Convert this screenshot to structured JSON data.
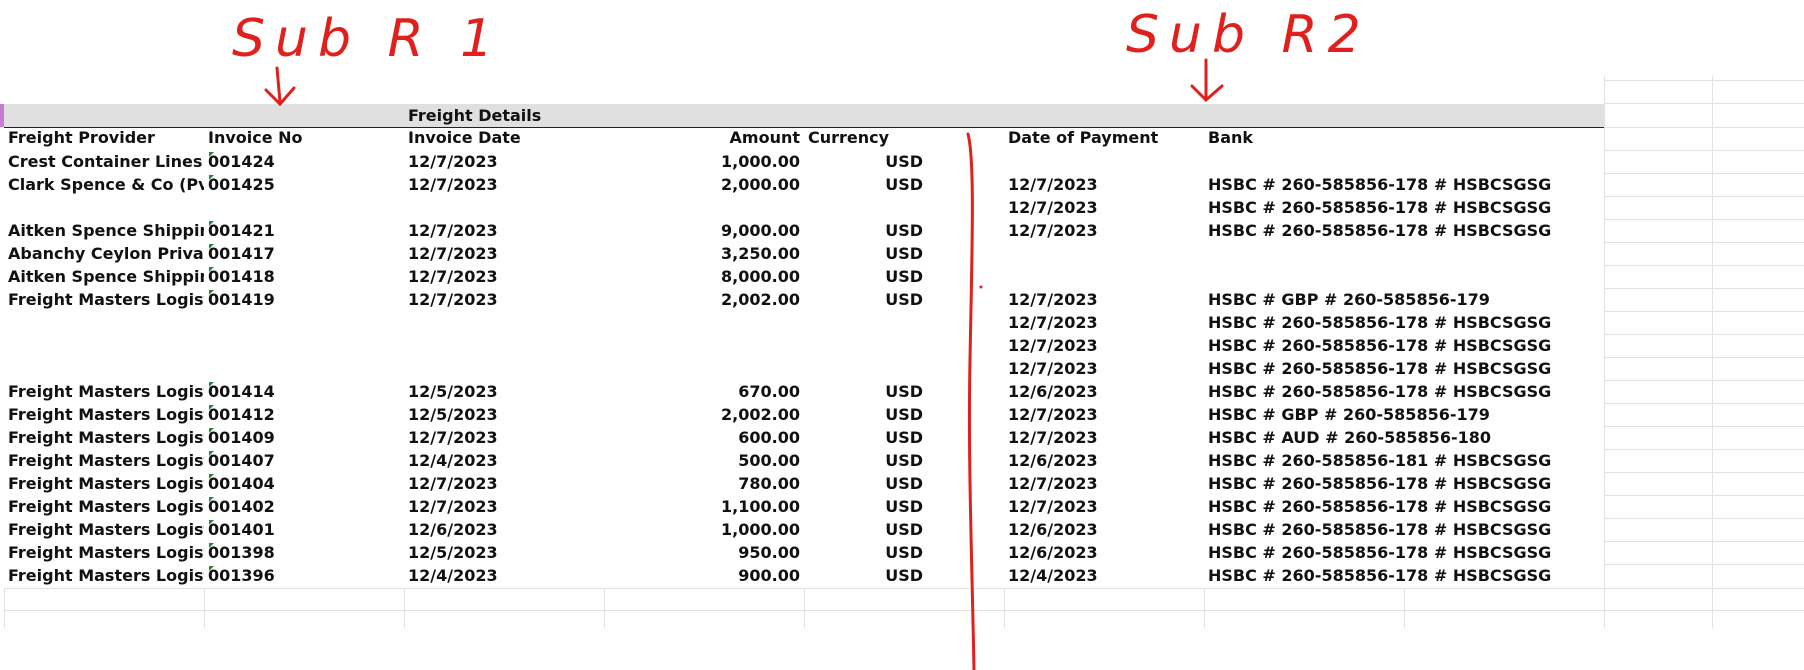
{
  "section_title": "Freight Details",
  "columns": {
    "provider": "Freight Provider",
    "invoice_no": "Invoice No",
    "invoice_date": "Invoice Date",
    "amount": "Amount",
    "currency": "Currency",
    "payment_date": "Date of Payment",
    "bank": "Bank"
  },
  "annotations": {
    "left": "Sub R 1",
    "right": "Sub R2",
    "annotation_color": "#e0201c"
  },
  "rows": [
    {
      "provider": "Crest Container Lines In",
      "invoice_no": "001424",
      "invoice_date": "12/7/2023",
      "amount": "1,000.00",
      "currency": "USD",
      "payment_date": "",
      "bank": ""
    },
    {
      "provider": "Clark Spence & Co (Pvt)",
      "invoice_no": "001425",
      "invoice_date": "12/7/2023",
      "amount": "2,000.00",
      "currency": "USD",
      "payment_date": "12/7/2023",
      "bank": "HSBC # 260-585856-178 # HSBCSGSG"
    },
    {
      "provider": "",
      "invoice_no": "",
      "invoice_date": "",
      "amount": "",
      "currency": "",
      "payment_date": "12/7/2023",
      "bank": "HSBC # 260-585856-178 # HSBCSGSG"
    },
    {
      "provider": "Aitken Spence Shipping",
      "invoice_no": "001421",
      "invoice_date": "12/7/2023",
      "amount": "9,000.00",
      "currency": "USD",
      "payment_date": "12/7/2023",
      "bank": "HSBC # 260-585856-178 # HSBCSGSG"
    },
    {
      "provider": "Abanchy Ceylon Private",
      "invoice_no": "001417",
      "invoice_date": "12/7/2023",
      "amount": "3,250.00",
      "currency": "USD",
      "payment_date": "",
      "bank": ""
    },
    {
      "provider": "Aitken Spence Shipping",
      "invoice_no": "001418",
      "invoice_date": "12/7/2023",
      "amount": "8,000.00",
      "currency": "USD",
      "payment_date": "",
      "bank": ""
    },
    {
      "provider": "Freight Masters Logistic",
      "invoice_no": "001419",
      "invoice_date": "12/7/2023",
      "amount": "2,002.00",
      "currency": "USD",
      "payment_date": "12/7/2023",
      "bank": "HSBC # GBP # 260-585856-179"
    },
    {
      "provider": "",
      "invoice_no": "",
      "invoice_date": "",
      "amount": "",
      "currency": "",
      "payment_date": "12/7/2023",
      "bank": "HSBC # 260-585856-178 # HSBCSGSG"
    },
    {
      "provider": "",
      "invoice_no": "",
      "invoice_date": "",
      "amount": "",
      "currency": "",
      "payment_date": "12/7/2023",
      "bank": "HSBC # 260-585856-178 # HSBCSGSG"
    },
    {
      "provider": "",
      "invoice_no": "",
      "invoice_date": "",
      "amount": "",
      "currency": "",
      "payment_date": "12/7/2023",
      "bank": "HSBC # 260-585856-178 # HSBCSGSG"
    },
    {
      "provider": "Freight Masters Logistic",
      "invoice_no": "001414",
      "invoice_date": "12/5/2023",
      "amount": "670.00",
      "currency": "USD",
      "payment_date": "12/6/2023",
      "bank": "HSBC # 260-585856-178 # HSBCSGSG"
    },
    {
      "provider": "Freight Masters Logistic",
      "invoice_no": "001412",
      "invoice_date": "12/5/2023",
      "amount": "2,002.00",
      "currency": "USD",
      "payment_date": "12/7/2023",
      "bank": "HSBC # GBP # 260-585856-179"
    },
    {
      "provider": "Freight Masters Logistic",
      "invoice_no": "001409",
      "invoice_date": "12/7/2023",
      "amount": "600.00",
      "currency": "USD",
      "payment_date": "12/7/2023",
      "bank": "HSBC # AUD # 260-585856-180"
    },
    {
      "provider": "Freight Masters Logistic",
      "invoice_no": "001407",
      "invoice_date": "12/4/2023",
      "amount": "500.00",
      "currency": "USD",
      "payment_date": "12/6/2023",
      "bank": "HSBC # 260-585856-181 # HSBCSGSG"
    },
    {
      "provider": "Freight Masters Logistic",
      "invoice_no": "001404",
      "invoice_date": "12/7/2023",
      "amount": "780.00",
      "currency": "USD",
      "payment_date": "12/7/2023",
      "bank": "HSBC # 260-585856-178 # HSBCSGSG"
    },
    {
      "provider": "Freight Masters Logistic",
      "invoice_no": "001402",
      "invoice_date": "12/7/2023",
      "amount": "1,100.00",
      "currency": "USD",
      "payment_date": "12/7/2023",
      "bank": "HSBC # 260-585856-178 # HSBCSGSG"
    },
    {
      "provider": "Freight Masters Logistic",
      "invoice_no": "001401",
      "invoice_date": "12/6/2023",
      "amount": "1,000.00",
      "currency": "USD",
      "payment_date": "12/6/2023",
      "bank": "HSBC # 260-585856-178 # HSBCSGSG"
    },
    {
      "provider": "Freight Masters Logistic",
      "invoice_no": "001398",
      "invoice_date": "12/5/2023",
      "amount": "950.00",
      "currency": "USD",
      "payment_date": "12/6/2023",
      "bank": "HSBC # 260-585856-178 # HSBCSGSG"
    },
    {
      "provider": "Freight Masters Logistic",
      "invoice_no": "001396",
      "invoice_date": "12/4/2023",
      "amount": "900.00",
      "currency": "USD",
      "payment_date": "12/4/2023",
      "bank": "HSBC # 260-585856-178 # HSBCSGSG"
    }
  ]
}
